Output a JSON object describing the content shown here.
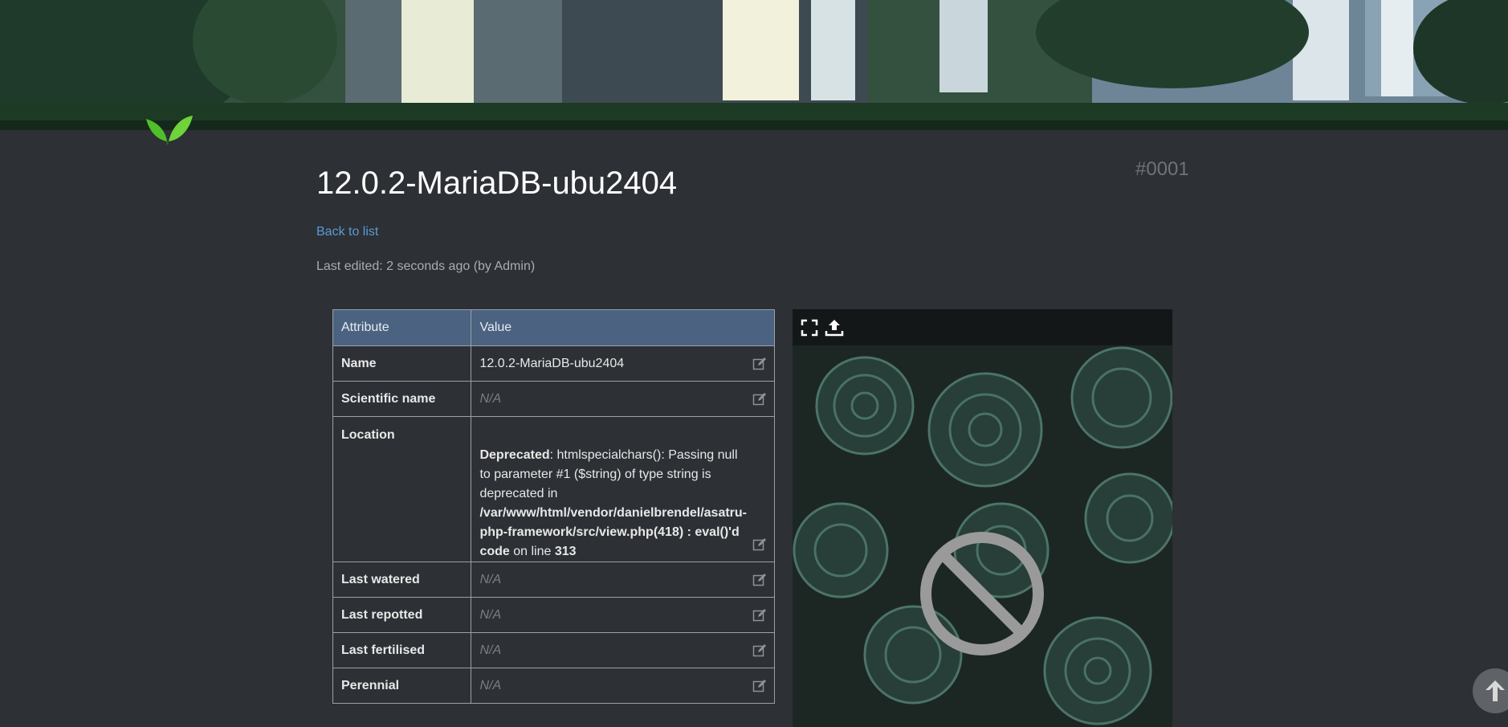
{
  "plant": {
    "id_label": "#0001",
    "title": "12.0.2-MariaDB-ubu2404",
    "back_link": "Back to list",
    "last_edited": "Last edited: 2 seconds ago (by Admin)"
  },
  "table": {
    "headers": {
      "attribute": "Attribute",
      "value": "Value"
    },
    "rows": {
      "name": {
        "label": "Name",
        "value": "12.0.2-MariaDB-ubu2404"
      },
      "scientific_name": {
        "label": "Scientific name",
        "value": "N/A"
      },
      "location": {
        "label": "Location",
        "warning_prefix": "Deprecated",
        "warning_text": ": htmlspecialchars(): Passing null to parameter #1 ($string) of type string is deprecated in ",
        "warning_path": "/var/www/html/vendor/danielbrendel/asatru-php-framework/src/view.php(418) : eval()'d code",
        "warning_on_line": " on line ",
        "warning_line_number": "313"
      },
      "last_watered": {
        "label": "Last watered",
        "value": "N/A"
      },
      "last_repotted": {
        "label": "Last repotted",
        "value": "N/A"
      },
      "last_fertilised": {
        "label": "Last fertilised",
        "value": "N/A"
      },
      "perennial": {
        "label": "Perennial",
        "value": "N/A"
      }
    }
  },
  "photo": {
    "toolbar_icons": [
      "expand-icon",
      "upload-icon"
    ],
    "placeholder_icon": "no-photo-icon"
  },
  "icons": {
    "edit": "edit-icon",
    "scroll_top": "arrow-up-icon",
    "logo": "leaf-logo-icon"
  },
  "colors": {
    "background": "#2d3035",
    "table_header": "#4b6381",
    "link": "#5b9bd5",
    "muted": "#6f737a"
  }
}
